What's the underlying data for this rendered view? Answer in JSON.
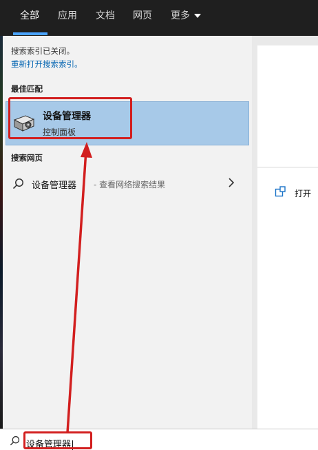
{
  "tabs": [
    {
      "label": "全部"
    },
    {
      "label": "应用"
    },
    {
      "label": "文档"
    },
    {
      "label": "网页"
    },
    {
      "label": "更多"
    }
  ],
  "notice": {
    "text": "搜索索引已关闭。",
    "link": "重新打开搜索索引。"
  },
  "best_match": {
    "section": "最佳匹配",
    "title": "设备管理器",
    "subtitle": "控制面板",
    "icon": "device-manager-icon"
  },
  "web": {
    "section": "搜索网页",
    "query": "设备管理器",
    "hint": " - 查看网络搜索结果"
  },
  "right_panel": {
    "open_label": "打开"
  },
  "search": {
    "value": "设备管理器"
  },
  "colors": {
    "accent": "#4aa3ff",
    "selection": "#a7c9e8",
    "annotation": "#d21f1f",
    "link": "#0063b1"
  }
}
